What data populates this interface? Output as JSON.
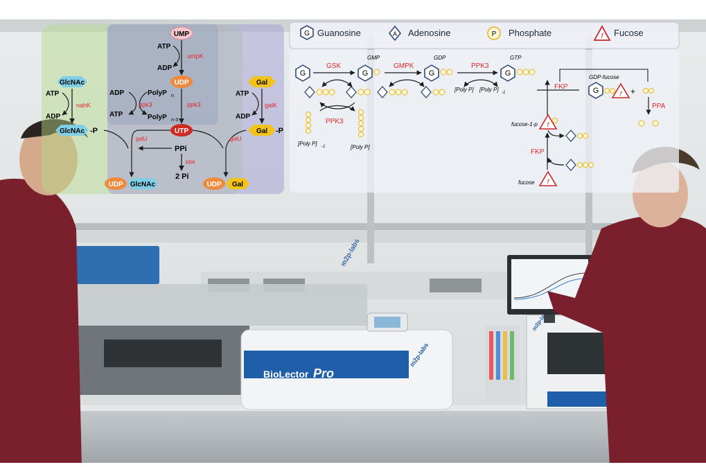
{
  "legend": {
    "guanosine": {
      "symbol": "G",
      "label": "Guanosine"
    },
    "adenosine": {
      "symbol": "A",
      "label": "Adenosine"
    },
    "phosphate": {
      "symbol": "P",
      "label": "Phosphate"
    },
    "fucose": {
      "symbol": "f",
      "label": "Fucose"
    }
  },
  "left_pathway": {
    "glcnac_branch": {
      "substrate": "GlcNAc",
      "atp": "ATP",
      "adp": "ADP",
      "enzyme": "nahK",
      "phosphate_label": "GlcNAc",
      "phosphate_suffix": "-P",
      "enzyme_glmu": "galU",
      "product_udp": "UDP",
      "product_sugar": "GlcNAc"
    },
    "udp_branch": {
      "ump": "UMP",
      "atp": "ATP",
      "adp": "ADP",
      "enzyme_umpk": "umpK",
      "udp": "UDP",
      "adp2": "ADP",
      "atp2": "ATP",
      "enzyme_ppk3": "ppk3",
      "polyp_n": "PolyP",
      "polyp_n_sub": "n",
      "polyp_n3": "PolyP",
      "polyp_n3_sub": "n-3",
      "enzyme_ppk3_b": "ppk3",
      "utp": "UTP",
      "ppi": "PPi",
      "enzyme_ppa": "ppa",
      "pi": "2 Pi"
    },
    "gal_branch": {
      "substrate": "Gal",
      "atp": "ATP",
      "adp": "ADP",
      "enzyme": "galK",
      "phosphate_label": "Gal",
      "phosphate_suffix": "-P",
      "enzyme_galu": "galU",
      "product_udp": "UDP",
      "product_sugar": "Gal"
    }
  },
  "right_pathway": {
    "gsk": "GSK",
    "gmpk": "GMPK",
    "ppk3_top": "PPK3",
    "ppk3_bottom": "PPK3",
    "gmp": "GMP",
    "gdp": "GDP",
    "gtp": "GTP",
    "polyp_left": "[Poly P]",
    "polyp_left_sub": "-1",
    "polyp_right": "[Poly P]",
    "polyp_mid_a": "[Poly P]",
    "polyp_mid_b": "[Poly P]",
    "polyp_mid_b_sub": "-1",
    "fkp_top": "FKP",
    "fkp_bottom": "FKP",
    "ppa": "PPA",
    "gdp_fucose": "GDP-fucose",
    "fucose_1p": "fucose-1-p",
    "fucose": "fucose",
    "plus": "+"
  },
  "photo": {
    "instrument_brand": "BioLector",
    "instrument_model": "Pro",
    "logo_lab_a": "m2p-labs",
    "logo_lab_b": "m2p-labs",
    "logo_lab_c": "m2p-labs"
  },
  "colors": {
    "enzyme_red": "#e3262a",
    "udp_orange": "#ef8a3d",
    "utp_red": "#cf2a24",
    "glcnac_blue": "#7fd0e6",
    "gal_yellow": "#f2c418",
    "ump_pink": "#f5c6cc",
    "phosphate_yellow": "#f5d25a",
    "lab_coat": "#7a1f2c"
  }
}
